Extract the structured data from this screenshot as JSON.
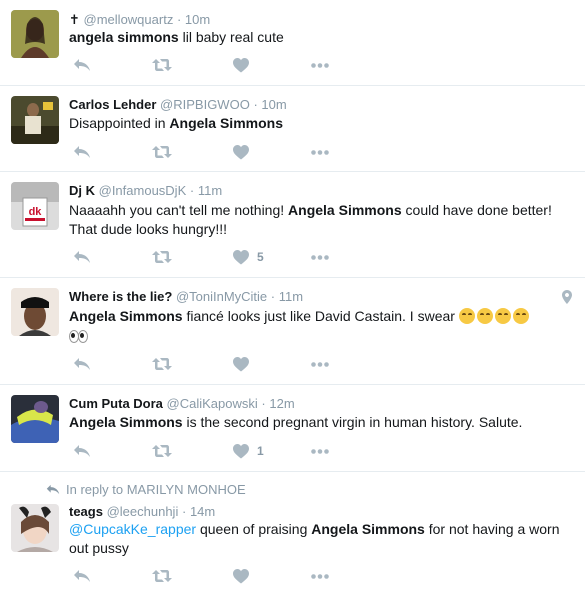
{
  "tweets": [
    {
      "name_prefix": "✝",
      "name": "",
      "handle": "@mellowquartz",
      "dot": "·",
      "time": "10m",
      "text": {
        "bold": "angela simmons",
        "rest": " lil baby real cute"
      },
      "likes": ""
    },
    {
      "name": "Carlos Lehder",
      "handle": "@RIPBIGWOO",
      "dot": "·",
      "time": "10m",
      "text": {
        "pre": "Disappointed in ",
        "bold": "Angela Simmons"
      },
      "likes": ""
    },
    {
      "name": "Dj K",
      "handle": "@InfamousDjK",
      "dot": "·",
      "time": "11m",
      "text": {
        "pre": "Naaaahh you can't tell me nothing! ",
        "bold": "Angela Simmons",
        "rest": " could have done better! That dude looks hungry!!!"
      },
      "likes": "5"
    },
    {
      "name": "Where is the lie?",
      "handle": "@ToniInMyCitie",
      "dot": "·",
      "time": "11m",
      "text": {
        "bold": "Angela Simmons",
        "rest": " fiancé looks just like David Castain. I swear "
      },
      "likes": ""
    },
    {
      "name": "Cum Puta Dora",
      "handle": "@CaliKapowski",
      "dot": "·",
      "time": "12m",
      "text": {
        "bold": "Angela Simmons",
        "rest": " is the second pregnant virgin in human history. Salute."
      },
      "likes": "1"
    },
    {
      "reply_context": "In reply to MARILYN MONHOE",
      "name": "teags",
      "handle": "@leechunhji",
      "dot": "·",
      "time": "14m",
      "text": {
        "mention": "@CupcakKe_rapper",
        "pre": " queen of praising ",
        "bold": "Angela Simmons",
        "rest": " for not having a worn out pussy"
      },
      "likes": ""
    }
  ],
  "icons": {
    "reply": "reply-icon",
    "retweet": "retweet-icon",
    "like": "heart-icon",
    "more": "more-icon",
    "location": "location-pin-icon"
  },
  "colors": {
    "text": "#14171a",
    "secondary": "#8899a6",
    "icon": "#aab8c2",
    "link": "#1da1f2",
    "divider": "#e6ecf0"
  }
}
